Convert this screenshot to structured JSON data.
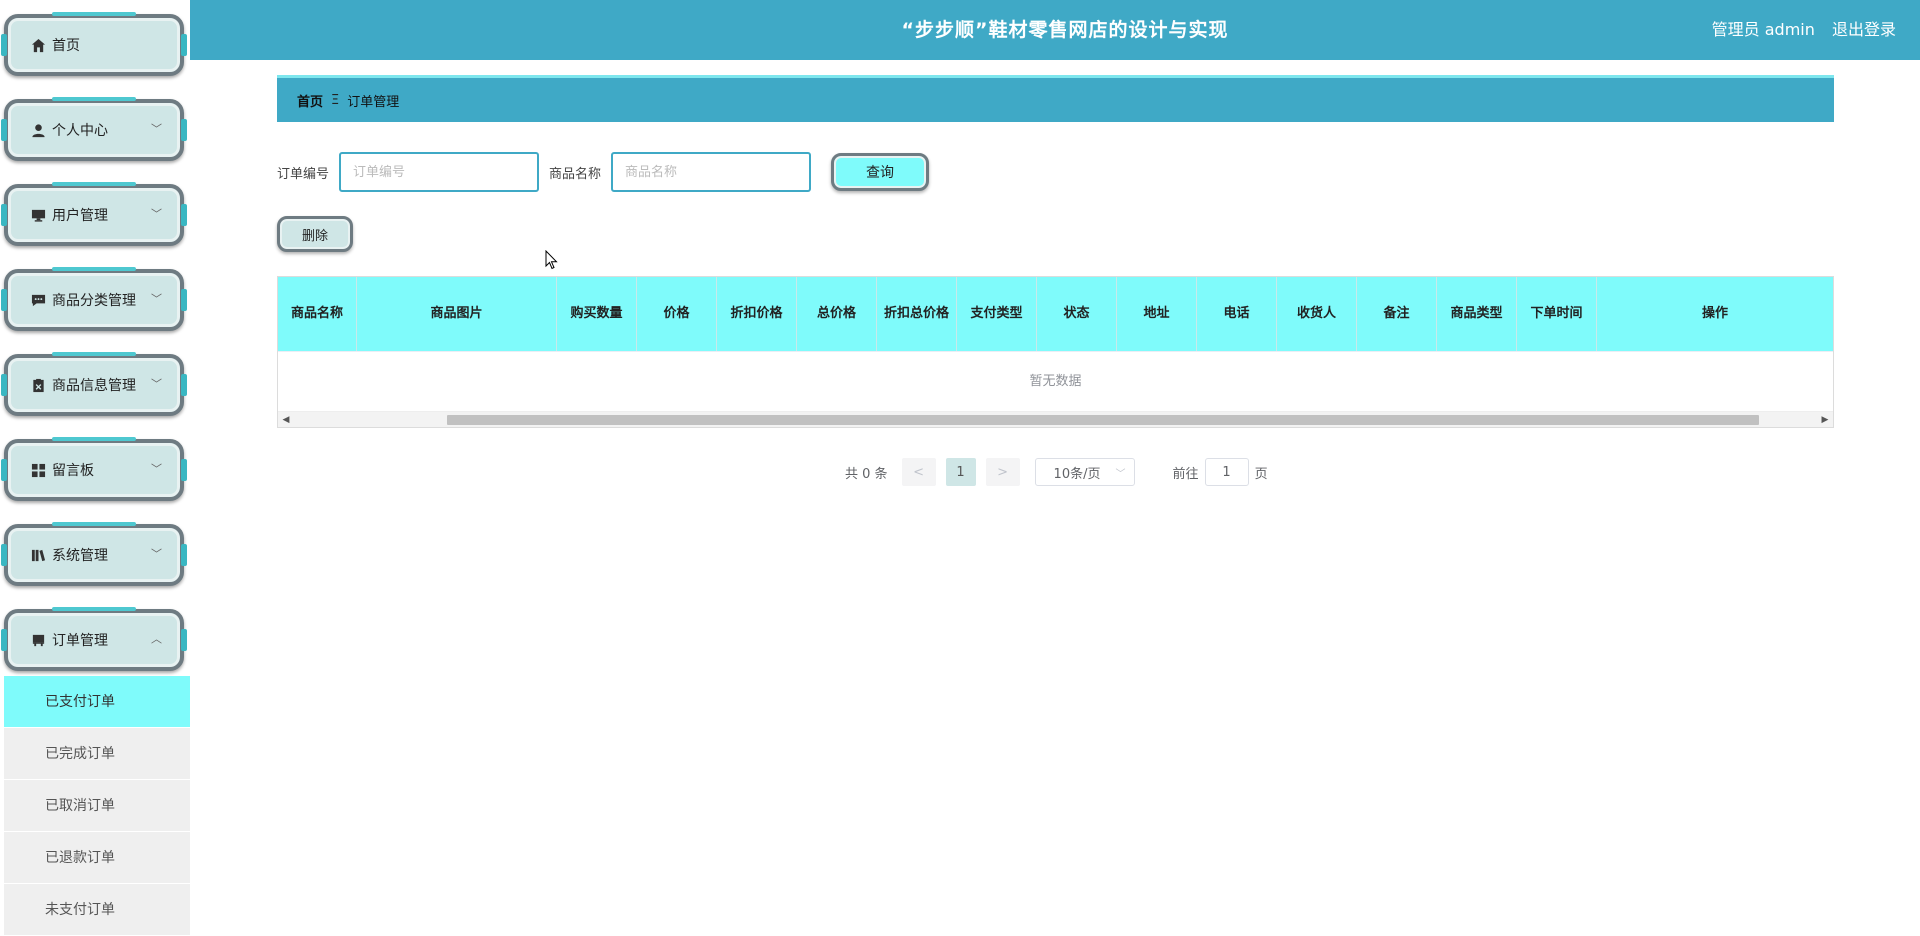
{
  "header": {
    "title": "“步步顺”鞋材零售网店的设计与实现",
    "user_label": "管理员 admin",
    "logout_label": "退出登录"
  },
  "sidebar": {
    "items": [
      {
        "label": "首页",
        "icon": "home-icon"
      },
      {
        "label": "个人中心",
        "icon": "user-icon"
      },
      {
        "label": "用户管理",
        "icon": "monitor-icon"
      },
      {
        "label": "商品分类管理",
        "icon": "chat-icon"
      },
      {
        "label": "商品信息管理",
        "icon": "clipboard-icon"
      },
      {
        "label": "留言板",
        "icon": "grid-icon"
      },
      {
        "label": "系统管理",
        "icon": "book-icon"
      },
      {
        "label": "订单管理",
        "icon": "store-icon"
      }
    ],
    "submenu": [
      {
        "label": "已支付订单",
        "active": true
      },
      {
        "label": "已完成订单"
      },
      {
        "label": "已取消订单"
      },
      {
        "label": "已退款订单"
      },
      {
        "label": "未支付订单"
      }
    ]
  },
  "breadcrumb": {
    "home": "首页",
    "separator": "Ξ",
    "current": "订单管理"
  },
  "search": {
    "order_no_label": "订单编号",
    "order_no_placeholder": "订单编号",
    "goods_name_label": "商品名称",
    "goods_name_placeholder": "商品名称",
    "query_label": "查询"
  },
  "actions": {
    "delete_label": "删除"
  },
  "table": {
    "columns": [
      "商品名称",
      "商品图片",
      "购买数量",
      "价格",
      "折扣价格",
      "总价格",
      "折扣总价格",
      "支付类型",
      "状态",
      "地址",
      "电话",
      "收货人",
      "备注",
      "商品类型",
      "下单时间",
      "操作"
    ],
    "empty_text": "暂无数据"
  },
  "pagination": {
    "total_text": "共 0 条",
    "prev": "<",
    "current_page": "1",
    "next": ">",
    "page_size": "10条/页",
    "goto_prefix": "前往",
    "goto_value": "1",
    "goto_suffix": "页"
  }
}
